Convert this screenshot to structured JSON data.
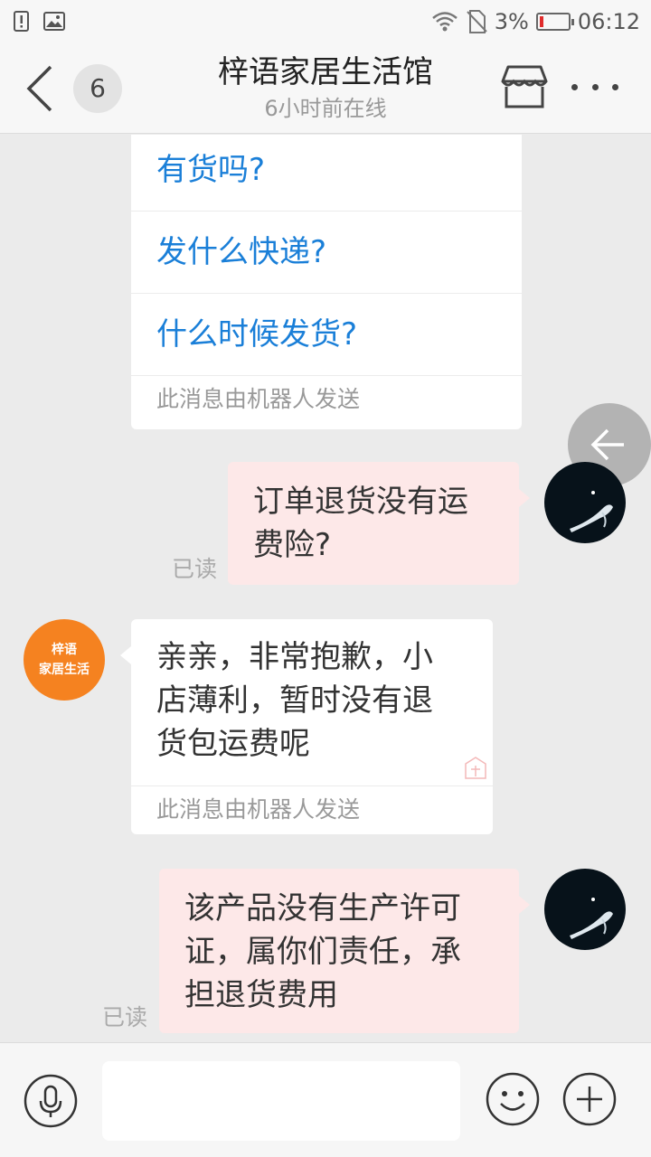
{
  "status_bar": {
    "battery": "3%",
    "time": "06:12",
    "icons": [
      "alert-icon",
      "image-icon",
      "wifi-icon",
      "no-sim-icon",
      "battery-icon"
    ]
  },
  "header": {
    "badge_count": "6",
    "title": "梓语家居生活馆",
    "subtitle": "6小时前在线",
    "icons": [
      "back-icon",
      "store-icon",
      "more-icon"
    ]
  },
  "chat": {
    "quick_questions": [
      "有货吗?",
      "发什么快递?",
      "什么时候发货?"
    ],
    "quick_note": "此消息由机器人发送",
    "msg1": {
      "lines": [
        "订单退货没有运",
        "费险?"
      ],
      "status": "已读"
    },
    "shop_avatar": {
      "line1": "梓语",
      "line2": "家居生活"
    },
    "reply": {
      "lines": [
        "亲亲，非常抱歉，小",
        "店薄利，暂时没有退",
        "货包运费呢"
      ],
      "note": "此消息由机器人发送"
    },
    "msg2": {
      "lines": [
        "该产品没有生产许可",
        "证，属你们责任，承",
        "担退货费用"
      ],
      "status": "已读"
    }
  },
  "input_bar": {
    "placeholder": "",
    "icons": [
      "mic-icon",
      "emoji-icon",
      "plus-icon"
    ]
  },
  "colors": {
    "link_blue": "#1a7fd8",
    "outgoing_bubble": "#fde8e8",
    "shop_orange": "#f58220",
    "background": "#ebebeb"
  }
}
